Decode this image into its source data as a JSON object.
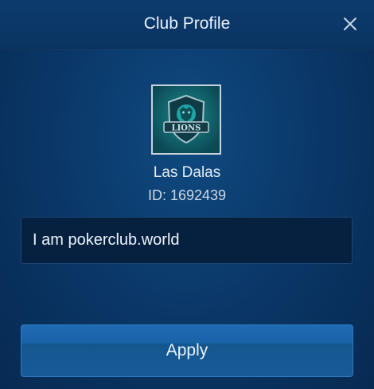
{
  "dialog": {
    "title": "Club Profile"
  },
  "club": {
    "logo_text": "LIONS",
    "name": "Las Dalas",
    "id_text": "ID: 1692439",
    "description": "I am pokerclub.world"
  },
  "actions": {
    "apply_label": "Apply"
  },
  "icons": {
    "close": "close-icon"
  },
  "colors": {
    "background": "#0a3565",
    "header": "#0c3b6d",
    "button": "#1a62a8",
    "text": "#e8f1fb"
  }
}
